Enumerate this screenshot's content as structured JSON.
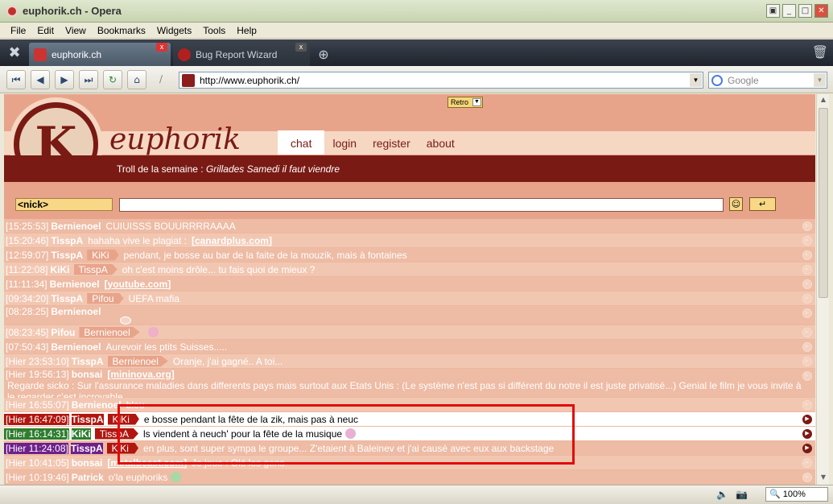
{
  "window": {
    "title": "euphorik.ch - Opera",
    "buttons": [
      "▣",
      "_",
      "□",
      "✕"
    ]
  },
  "menu": [
    "File",
    "Edit",
    "View",
    "Bookmarks",
    "Widgets",
    "Tools",
    "Help"
  ],
  "tabs": [
    {
      "label": "euphorik.ch",
      "active": true
    },
    {
      "label": "Bug Report Wizard",
      "active": false
    }
  ],
  "address": {
    "url": "http://www.euphorik.ch/",
    "search_placeholder": "Google"
  },
  "site": {
    "retro_label": "Retro",
    "brand": "euphorik",
    "nav": [
      "chat",
      "login",
      "register",
      "about"
    ],
    "troll_prefix": "Troll de la semaine : ",
    "troll_text": "Grillades Samedi il faut viendre",
    "nick_value": "<nick>"
  },
  "messages": [
    {
      "time": "[15:25:53]",
      "author": "Bernienoel",
      "text": "CUIUISSS BOUURRRRAAAA"
    },
    {
      "time": "[15:20:46]",
      "author": "TisspA",
      "text": "hahaha vive le plagiat :",
      "link": "[canardplus.com]"
    },
    {
      "time": "[12:59:07]",
      "author": "TisspA",
      "rcpt": "KiKi",
      "text": "pendant, je bosse au bar de la faite de la mouzik, mais à fontaines"
    },
    {
      "time": "[11:22:08]",
      "author": "KiKi",
      "rcpt": "TisspA",
      "text": "oh c'est moins drôle... tu fais quoi de mieux ?"
    },
    {
      "time": "[11:11:34]",
      "author": "Bernienoel",
      "link": "[youtube.com]"
    },
    {
      "time": "[09:34:20]",
      "author": "TisspA",
      "rcpt": "Pifou",
      "text": "UEFA mafia"
    },
    {
      "time": "[08:28:25]",
      "author": "Bernienoel",
      "text": ""
    },
    {
      "time": "[08:23:45]",
      "author": "Pifou",
      "rcpt": "Bernienoel",
      "text": ""
    },
    {
      "time": "[07:50:43]",
      "author": "Bernienoel",
      "text": "Aurevoir les ptits Suisses....."
    },
    {
      "time": "[Hier 23:53:10]",
      "author": "TisspA",
      "rcpt": "Bernienoel",
      "text": "Oranje, j'ai gagné.. A toi..."
    },
    {
      "time": "[Hier 19:56:13]",
      "author": "bonsai",
      "link": "[mininova.org]",
      "text": "Regarde sicko : Sur l'assurance maladies dans differents pays mais surtout aux Etats Unis : (Le système n'est pas si différent du notre il est juste privatisé...) Genial le film je vous invite à le regarder c'est incroyable"
    },
    {
      "time": "[Hier 16:55:07]",
      "author": "Bernienoel",
      "text": "bleu"
    },
    {
      "time": "[Hier 16:47:09]",
      "author": "TisspA",
      "rcpt": "KiKi",
      "text": "e bosse pendant la fête de la zik, mais pas à neuc",
      "highlight": "red"
    },
    {
      "time": "[Hier 16:14:31]",
      "author": "KiKi",
      "rcpt": "TisspA",
      "text": "ls viendent à neuch' pour la fête de la musique",
      "highlight": "green"
    },
    {
      "time": "[Hier 11:24:08]",
      "author": "TisspA",
      "rcpt": "KiKi",
      "text": "en plus, sont super sympa le groupe... Z'etaient à Baleinev et j'ai causé avec eux aux backstage",
      "highlight": "purple"
    },
    {
      "time": "[Hier 10:41:05]",
      "author": "bonsai",
      "link": "[metalbeast.com]",
      "text": "Je joue : Olé les gens"
    },
    {
      "time": "[Hier 10:19:46]",
      "author": "Patrick",
      "text": "o'la euphoriks"
    }
  ],
  "status": {
    "zoom": "100%"
  },
  "colors": {
    "brand": "#7a1a14",
    "page_bg": "#e8a48a",
    "highlight_box": "#e10b0b"
  }
}
